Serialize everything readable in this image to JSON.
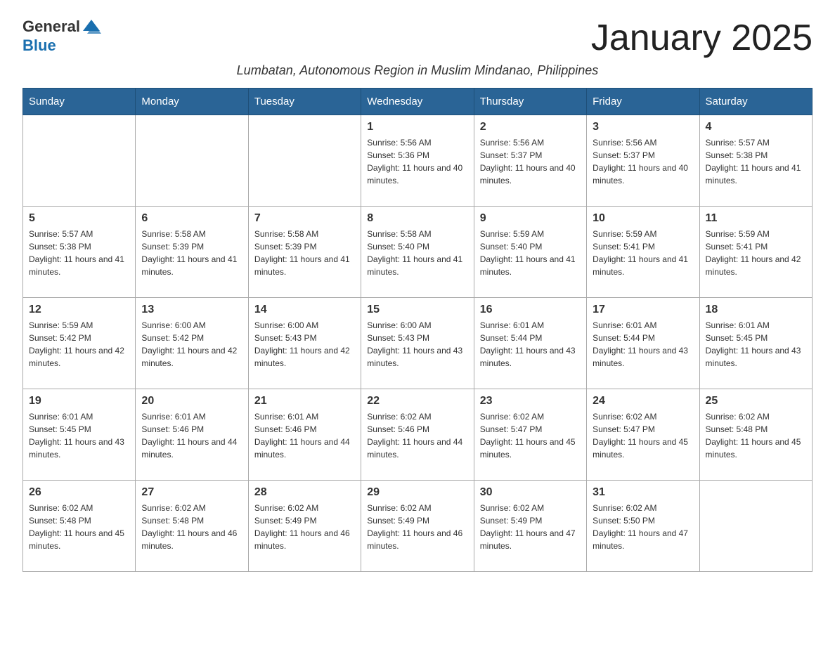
{
  "header": {
    "logo_general": "General",
    "logo_blue": "Blue",
    "month_title": "January 2025",
    "subtitle": "Lumbatan, Autonomous Region in Muslim Mindanao, Philippines"
  },
  "weekdays": [
    "Sunday",
    "Monday",
    "Tuesday",
    "Wednesday",
    "Thursday",
    "Friday",
    "Saturday"
  ],
  "weeks": [
    [
      {
        "day": "",
        "info": ""
      },
      {
        "day": "",
        "info": ""
      },
      {
        "day": "",
        "info": ""
      },
      {
        "day": "1",
        "info": "Sunrise: 5:56 AM\nSunset: 5:36 PM\nDaylight: 11 hours and 40 minutes."
      },
      {
        "day": "2",
        "info": "Sunrise: 5:56 AM\nSunset: 5:37 PM\nDaylight: 11 hours and 40 minutes."
      },
      {
        "day": "3",
        "info": "Sunrise: 5:56 AM\nSunset: 5:37 PM\nDaylight: 11 hours and 40 minutes."
      },
      {
        "day": "4",
        "info": "Sunrise: 5:57 AM\nSunset: 5:38 PM\nDaylight: 11 hours and 41 minutes."
      }
    ],
    [
      {
        "day": "5",
        "info": "Sunrise: 5:57 AM\nSunset: 5:38 PM\nDaylight: 11 hours and 41 minutes."
      },
      {
        "day": "6",
        "info": "Sunrise: 5:58 AM\nSunset: 5:39 PM\nDaylight: 11 hours and 41 minutes."
      },
      {
        "day": "7",
        "info": "Sunrise: 5:58 AM\nSunset: 5:39 PM\nDaylight: 11 hours and 41 minutes."
      },
      {
        "day": "8",
        "info": "Sunrise: 5:58 AM\nSunset: 5:40 PM\nDaylight: 11 hours and 41 minutes."
      },
      {
        "day": "9",
        "info": "Sunrise: 5:59 AM\nSunset: 5:40 PM\nDaylight: 11 hours and 41 minutes."
      },
      {
        "day": "10",
        "info": "Sunrise: 5:59 AM\nSunset: 5:41 PM\nDaylight: 11 hours and 41 minutes."
      },
      {
        "day": "11",
        "info": "Sunrise: 5:59 AM\nSunset: 5:41 PM\nDaylight: 11 hours and 42 minutes."
      }
    ],
    [
      {
        "day": "12",
        "info": "Sunrise: 5:59 AM\nSunset: 5:42 PM\nDaylight: 11 hours and 42 minutes."
      },
      {
        "day": "13",
        "info": "Sunrise: 6:00 AM\nSunset: 5:42 PM\nDaylight: 11 hours and 42 minutes."
      },
      {
        "day": "14",
        "info": "Sunrise: 6:00 AM\nSunset: 5:43 PM\nDaylight: 11 hours and 42 minutes."
      },
      {
        "day": "15",
        "info": "Sunrise: 6:00 AM\nSunset: 5:43 PM\nDaylight: 11 hours and 43 minutes."
      },
      {
        "day": "16",
        "info": "Sunrise: 6:01 AM\nSunset: 5:44 PM\nDaylight: 11 hours and 43 minutes."
      },
      {
        "day": "17",
        "info": "Sunrise: 6:01 AM\nSunset: 5:44 PM\nDaylight: 11 hours and 43 minutes."
      },
      {
        "day": "18",
        "info": "Sunrise: 6:01 AM\nSunset: 5:45 PM\nDaylight: 11 hours and 43 minutes."
      }
    ],
    [
      {
        "day": "19",
        "info": "Sunrise: 6:01 AM\nSunset: 5:45 PM\nDaylight: 11 hours and 43 minutes."
      },
      {
        "day": "20",
        "info": "Sunrise: 6:01 AM\nSunset: 5:46 PM\nDaylight: 11 hours and 44 minutes."
      },
      {
        "day": "21",
        "info": "Sunrise: 6:01 AM\nSunset: 5:46 PM\nDaylight: 11 hours and 44 minutes."
      },
      {
        "day": "22",
        "info": "Sunrise: 6:02 AM\nSunset: 5:46 PM\nDaylight: 11 hours and 44 minutes."
      },
      {
        "day": "23",
        "info": "Sunrise: 6:02 AM\nSunset: 5:47 PM\nDaylight: 11 hours and 45 minutes."
      },
      {
        "day": "24",
        "info": "Sunrise: 6:02 AM\nSunset: 5:47 PM\nDaylight: 11 hours and 45 minutes."
      },
      {
        "day": "25",
        "info": "Sunrise: 6:02 AM\nSunset: 5:48 PM\nDaylight: 11 hours and 45 minutes."
      }
    ],
    [
      {
        "day": "26",
        "info": "Sunrise: 6:02 AM\nSunset: 5:48 PM\nDaylight: 11 hours and 45 minutes."
      },
      {
        "day": "27",
        "info": "Sunrise: 6:02 AM\nSunset: 5:48 PM\nDaylight: 11 hours and 46 minutes."
      },
      {
        "day": "28",
        "info": "Sunrise: 6:02 AM\nSunset: 5:49 PM\nDaylight: 11 hours and 46 minutes."
      },
      {
        "day": "29",
        "info": "Sunrise: 6:02 AM\nSunset: 5:49 PM\nDaylight: 11 hours and 46 minutes."
      },
      {
        "day": "30",
        "info": "Sunrise: 6:02 AM\nSunset: 5:49 PM\nDaylight: 11 hours and 47 minutes."
      },
      {
        "day": "31",
        "info": "Sunrise: 6:02 AM\nSunset: 5:50 PM\nDaylight: 11 hours and 47 minutes."
      },
      {
        "day": "",
        "info": ""
      }
    ]
  ]
}
